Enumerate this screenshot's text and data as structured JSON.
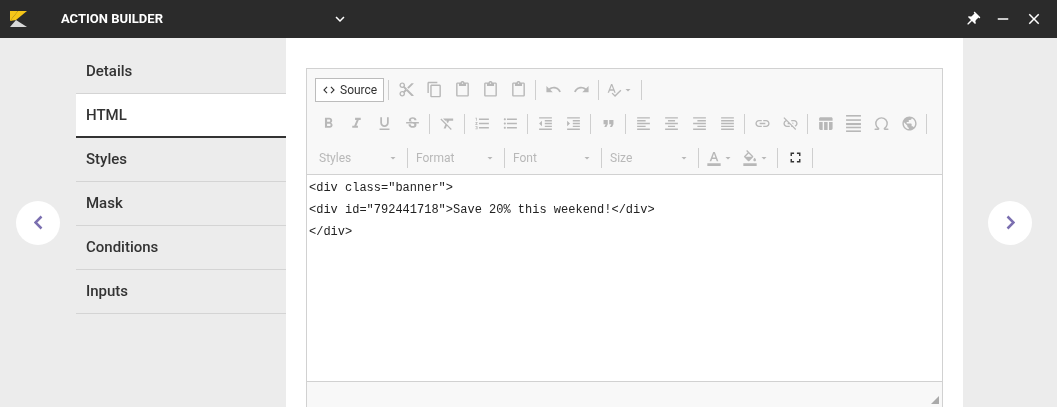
{
  "window": {
    "title": "ACTION BUILDER"
  },
  "sidebar": {
    "items": [
      {
        "label": "Details",
        "selected": false
      },
      {
        "label": "HTML",
        "selected": true
      },
      {
        "label": "Styles",
        "selected": false
      },
      {
        "label": "Mask",
        "selected": false
      },
      {
        "label": "Conditions",
        "selected": false
      },
      {
        "label": "Inputs",
        "selected": false
      }
    ]
  },
  "toolbar": {
    "rows": [
      [
        [
          {
            "kind": "button",
            "label": "Source",
            "disabled": false
          }
        ],
        [
          {
            "kind": "button",
            "disabled": true
          },
          {
            "kind": "button",
            "disabled": true
          },
          {
            "kind": "button",
            "disabled": true
          },
          {
            "kind": "button",
            "disabled": true
          },
          {
            "kind": "button",
            "disabled": true
          }
        ],
        [
          {
            "kind": "button",
            "disabled": true
          },
          {
            "kind": "button",
            "disabled": true
          }
        ],
        [
          {
            "kind": "menu",
            "disabled": true
          }
        ]
      ],
      [
        [
          {
            "kind": "button",
            "disabled": true
          },
          {
            "kind": "button",
            "disabled": true
          },
          {
            "kind": "button",
            "disabled": true
          },
          {
            "kind": "button",
            "disabled": true
          }
        ],
        [
          {
            "kind": "button",
            "disabled": true
          }
        ],
        [
          {
            "kind": "button",
            "disabled": true
          },
          {
            "kind": "button",
            "disabled": true
          }
        ],
        [
          {
            "kind": "button",
            "disabled": true
          },
          {
            "kind": "button",
            "disabled": true
          }
        ],
        [
          {
            "kind": "button",
            "disabled": true
          }
        ],
        [
          {
            "kind": "button",
            "disabled": true
          },
          {
            "kind": "button",
            "disabled": true
          },
          {
            "kind": "button",
            "disabled": true
          },
          {
            "kind": "button",
            "disabled": true
          }
        ],
        [
          {
            "kind": "button",
            "disabled": true
          },
          {
            "kind": "button",
            "disabled": true
          }
        ],
        [
          {
            "kind": "button",
            "disabled": true
          },
          {
            "kind": "button",
            "disabled": true
          },
          {
            "kind": "button",
            "disabled": true
          },
          {
            "kind": "button",
            "disabled": true
          }
        ]
      ],
      [
        [
          {
            "kind": "combo",
            "placeholder": "Styles",
            "disabled": true
          }
        ],
        [
          {
            "kind": "combo",
            "placeholder": "Format",
            "disabled": true
          }
        ],
        [
          {
            "kind": "combo",
            "placeholder": "Font",
            "disabled": true
          }
        ],
        [
          {
            "kind": "combo",
            "placeholder": "Size",
            "disabled": true
          }
        ],
        [
          {
            "kind": "menu",
            "disabled": true
          },
          {
            "kind": "menu",
            "disabled": true
          }
        ],
        [
          {
            "kind": "button",
            "disabled": false
          }
        ]
      ]
    ]
  },
  "editor": {
    "lines": [
      "<div class=\"banner\">",
      "<div id=\"792441718\">Save 20% this weekend!</div>",
      "</div>"
    ]
  }
}
